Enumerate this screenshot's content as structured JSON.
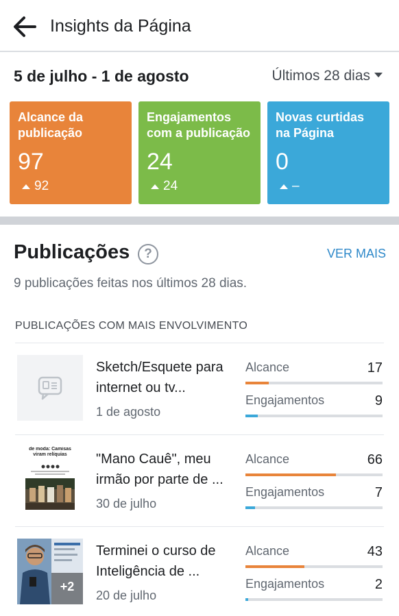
{
  "header": {
    "title": "Insights da Página",
    "back_icon": "arrow-left-icon"
  },
  "summary": {
    "date_range": "5 de julho - 1 de agosto",
    "period_label": "Últimos 28 dias",
    "cards": [
      {
        "label": "Alcance da publicação",
        "value": "97",
        "change": "92",
        "color": "#e8843a"
      },
      {
        "label": "Engajamentos com a publicação",
        "value": "24",
        "change": "24",
        "color": "#7cbb49"
      },
      {
        "label": "Novas curtidas na Página",
        "value": "0",
        "change": "–",
        "color": "#3ba8d9"
      }
    ]
  },
  "posts_section": {
    "title": "Publicações",
    "help_glyph": "?",
    "see_more": "VER MAIS",
    "subtitle": "9 publicações feitas nos últimos 28 dias.",
    "top_header": "PUBLICAÇÕES COM MAIS ENVOLVIMENTO",
    "reach_label": "Alcance",
    "engagement_label": "Engajamentos",
    "posts": [
      {
        "title": "Sketch/Esquete para internet ou tv...",
        "date": "1 de agosto",
        "reach": "17",
        "engagement": "9",
        "reach_fraction": 0.17,
        "engagement_fraction": 0.09
      },
      {
        "title": "\"Mano Cauê\", meu irmão por parte de ...",
        "date": "30 de julho",
        "reach": "66",
        "engagement": "7",
        "reach_fraction": 0.66,
        "engagement_fraction": 0.07,
        "thumb_text": "de moda: Camisas viram relíquias"
      },
      {
        "title": "Terminei o curso de Inteligência de ...",
        "date": "20 de julho",
        "reach": "43",
        "engagement": "2",
        "reach_fraction": 0.43,
        "engagement_fraction": 0.02,
        "thumb_overlay": "+2"
      }
    ]
  }
}
